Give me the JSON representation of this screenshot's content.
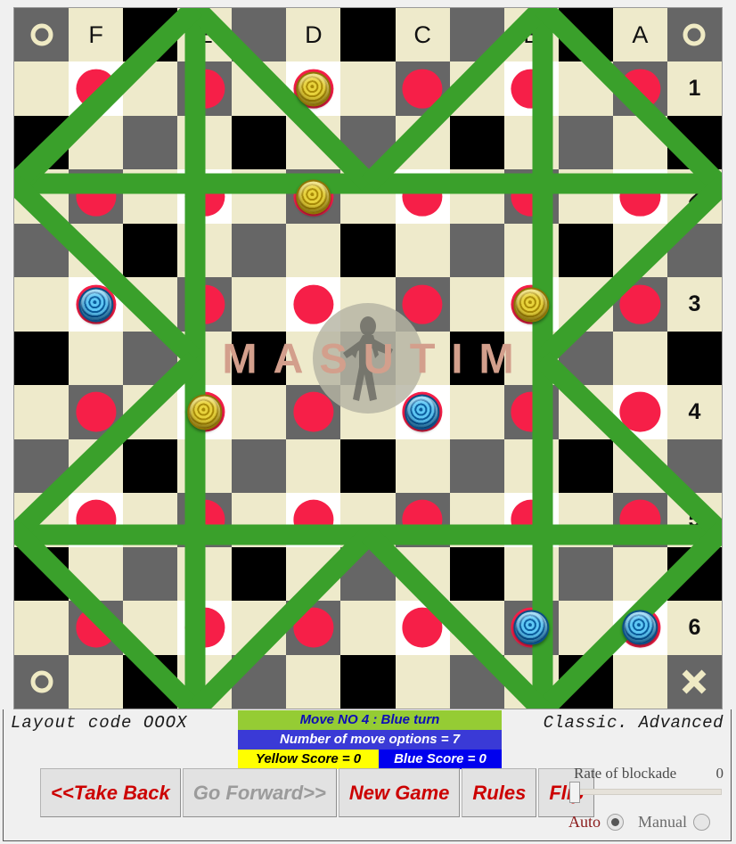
{
  "board": {
    "column_labels": [
      "F",
      "E",
      "D",
      "C",
      "B",
      "A"
    ],
    "row_labels": [
      "1",
      "2",
      "3",
      "4",
      "5",
      "6"
    ],
    "corner_marks": {
      "top_left": "O",
      "top_right": "O",
      "bottom_left": "O",
      "bottom_right": "X"
    },
    "watermark_text": "MASUTIM",
    "colors": {
      "cream": "#eeeacb",
      "gray": "#666666",
      "black": "#000000",
      "white": "#ffffff",
      "dot_red": "#f61f48",
      "path_green": "#3aa02b",
      "piece_yellow": "#e8d33c",
      "piece_blue": "#5fc8f5"
    },
    "pieces": [
      {
        "color": "yellow",
        "col": "D",
        "row": "1"
      },
      {
        "color": "yellow",
        "col": "D",
        "row": "2"
      },
      {
        "color": "yellow",
        "col": "B",
        "row": "3"
      },
      {
        "color": "yellow",
        "col": "E",
        "row": "4"
      },
      {
        "color": "blue",
        "col": "F",
        "row": "3"
      },
      {
        "color": "blue",
        "col": "C",
        "row": "4"
      },
      {
        "color": "blue",
        "col": "B",
        "row": "6"
      },
      {
        "color": "blue",
        "col": "A",
        "row": "6"
      }
    ]
  },
  "info": {
    "layout_code": "Layout code OOOX",
    "mode": "Classic. Advanced"
  },
  "status": {
    "turn": "Move NO 4 : Blue turn",
    "options": "Number of move options = 7",
    "yellow_score": "Yellow Score = 0",
    "blue_score": "Blue Score = 0"
  },
  "toolbar": {
    "take_back": "<<Take Back",
    "go_forward": "Go Forward>>",
    "new_game": "New Game",
    "rules": "Rules",
    "flip": "Flip"
  },
  "settings": {
    "rate_label": "Rate of blockade",
    "rate_value": "0",
    "auto_label": "Auto",
    "manual_label": "Manual",
    "selected_mode": "Auto"
  }
}
